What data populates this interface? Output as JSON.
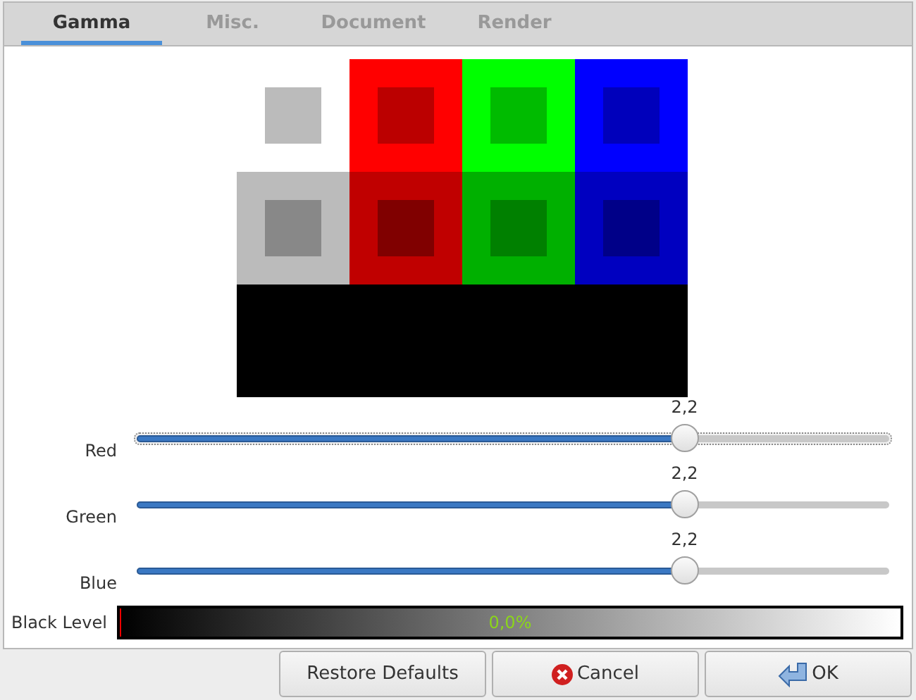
{
  "tabs": [
    {
      "label": "Gamma",
      "selected": true
    },
    {
      "label": "Misc.",
      "selected": false
    },
    {
      "label": "Document",
      "selected": false
    },
    {
      "label": "Render",
      "selected": false
    }
  ],
  "sliders": [
    {
      "label": "Red",
      "reading": "2,2",
      "level": 0.728,
      "focused": true
    },
    {
      "label": "Green",
      "reading": "2,2",
      "level": 0.728,
      "focused": false
    },
    {
      "label": "Blue",
      "reading": "2,2",
      "level": 0.728,
      "focused": false
    }
  ],
  "black_level": {
    "label": "Black Level",
    "reading": "0,0%",
    "level": 0
  },
  "buttons": [
    {
      "label": "Restore Defaults",
      "kind": "plain"
    },
    {
      "label": "Cancel",
      "kind": "cancel"
    },
    {
      "label": "OK",
      "kind": "ok"
    }
  ]
}
